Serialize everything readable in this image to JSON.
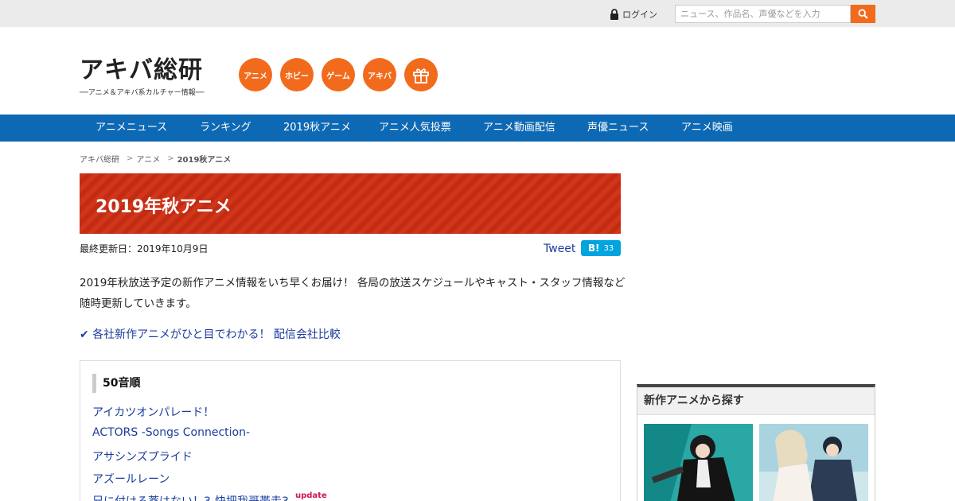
{
  "topbar": {
    "login_label": "ログイン",
    "search_placeholder": "ニュース、作品名、声優などを入力",
    "search_icon": "search-icon",
    "lock_icon": "lock-icon"
  },
  "header": {
    "logo_text": "アキバ総研",
    "logo_tagline": "──アニメ＆アキバ系カルチャー情報──",
    "categories": [
      "アニメ",
      "ホビー",
      "ゲーム",
      "アキバ"
    ],
    "gift_icon": "gift-icon",
    "accent_color": "#f26b1d"
  },
  "nav": {
    "items": [
      "アニメニュース",
      "ランキング",
      "2019秋アニメ",
      "アニメ人気投票",
      "アニメ動画配信",
      "声優ニュース",
      "アニメ映画"
    ],
    "color": "#0e69b4"
  },
  "breadcrumb": [
    "アキバ総研",
    "アニメ",
    "2019秋アニメ"
  ],
  "page": {
    "title": "2019年秋アニメ",
    "updated": "最終更新日：2019年10月9日",
    "tweet_label": "Tweet",
    "hatena_label": "B!",
    "hatena_count": "33",
    "intro": "2019年秋放送予定の新作アニメ情報をいち早くお届け！ 各局の放送スケジュールやキャスト・スタッフ情報など随時更新していきます。",
    "compare_link": "✔ 各社新作アニメがひと目でわかる！ 配信会社比較"
  },
  "list": {
    "heading": "50音順",
    "items": [
      "アイカツオンパレード！",
      "ACTORS -Songs Connection-",
      "アサシンズプライド",
      "アズールレーン",
      "兄に付ける薬はない！3-快把我哥帯走3-"
    ],
    "update_badge": "update"
  },
  "sidebar": {
    "heading": "新作アニメから探す"
  }
}
